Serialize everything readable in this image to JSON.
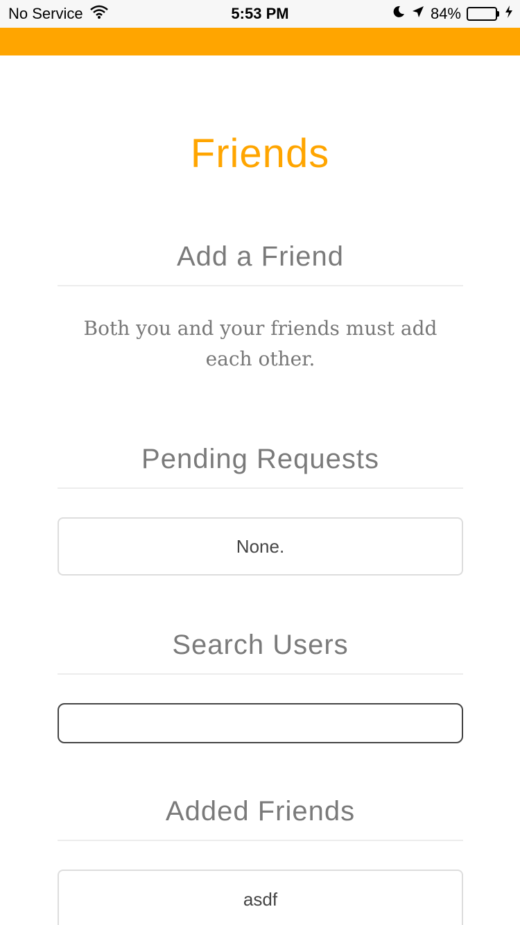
{
  "status_bar": {
    "carrier": "No Service",
    "time": "5:53 PM",
    "battery_percent": "84%",
    "battery_level": 0.84,
    "icons": [
      "wifi-icon",
      "moon-icon",
      "location-arrow-icon",
      "battery-icon",
      "charging-bolt-icon"
    ]
  },
  "colors": {
    "accent": "#ffa500",
    "heading_gray": "#7a7a7a",
    "battery_green": "#4cd964"
  },
  "page": {
    "title": "Friends"
  },
  "add_friend": {
    "heading": "Add a Friend",
    "description": "Both you and your friends must add each other."
  },
  "pending": {
    "heading": "Pending Requests",
    "empty_text": "None."
  },
  "search": {
    "heading": "Search Users",
    "value": "",
    "placeholder": ""
  },
  "added_friends": {
    "heading": "Added Friends",
    "items": [
      "asdf"
    ]
  }
}
